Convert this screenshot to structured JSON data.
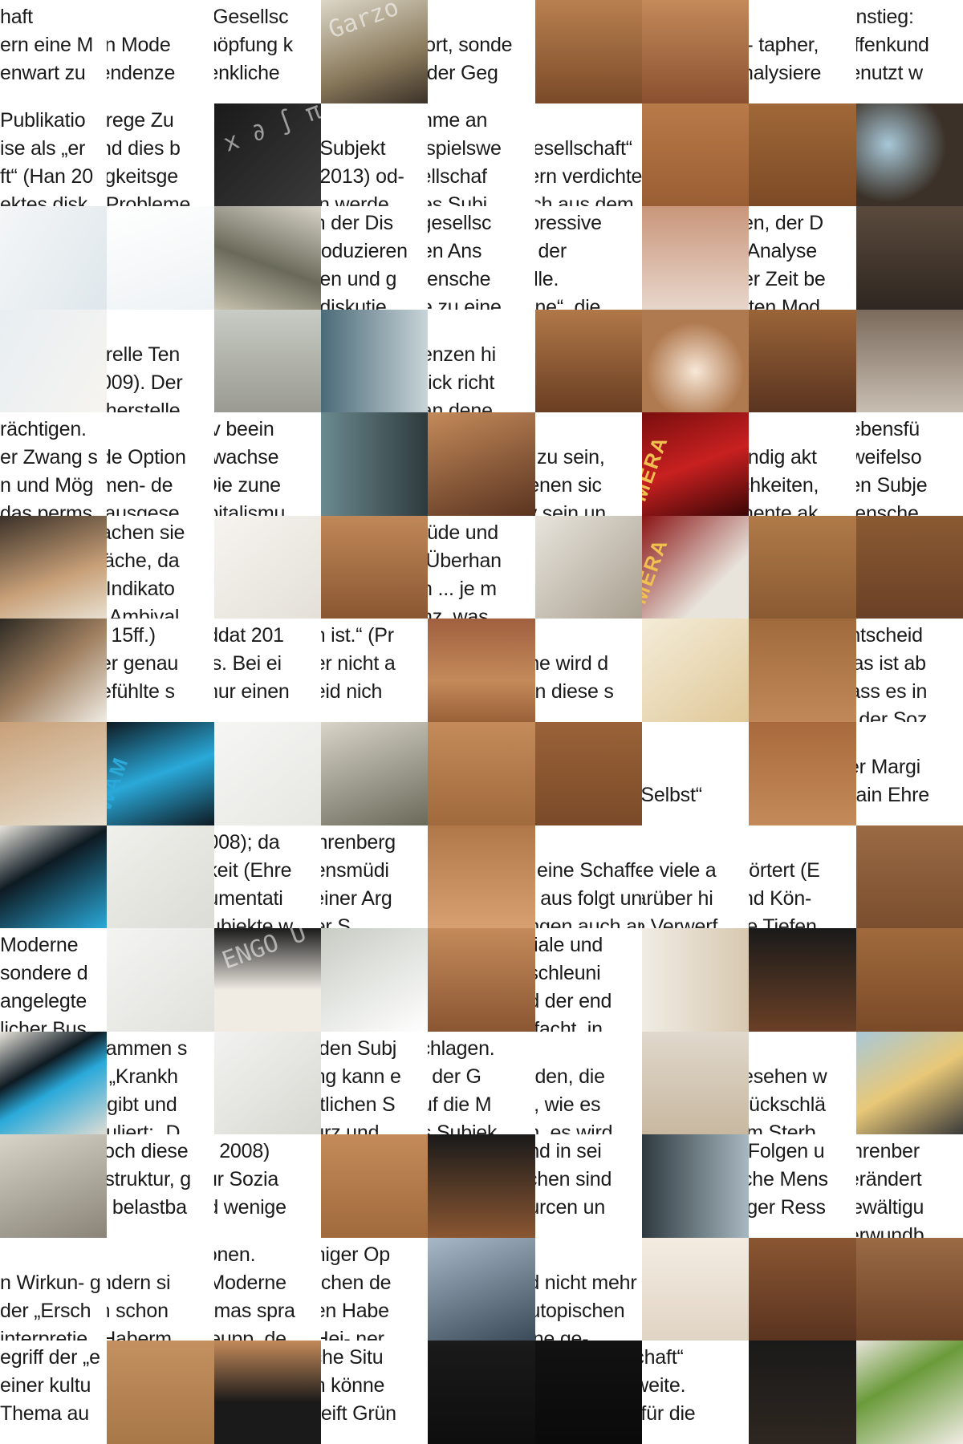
{
  "palette": {
    "skin_light": "#c48a5a",
    "skin_mid": "#a86a3c",
    "skin_dark": "#5a3420",
    "hair": "#3b3128",
    "sky": "#e7eef2",
    "book_red": "#a51a1a",
    "book_blue": "#2aa9d9",
    "chalkboard": "#2b2b2b",
    "paper": "#f2f0ea",
    "black": "#121212"
  },
  "cols": 9,
  "rows": 14,
  "tiles": [
    {
      "t": "text",
      "lines": [
        "haft",
        "ern eine M",
        "enwart zu"
      ]
    },
    {
      "t": "text",
      "lines": [
        "",
        "ein Mode",
        "Tendenze"
      ]
    },
    {
      "t": "text",
      "lines": [
        "e Gesellsc",
        "chöpfung k",
        "denkliche"
      ]
    },
    {
      "t": "photo",
      "bg": "linear-gradient(160deg,#dcd7c8,#8a7a5c 60%,#3b3128)",
      "glyph": "Garzo"
    },
    {
      "t": "text",
      "lines": [
        "",
        "wort, sonde",
        "n der Geg"
      ]
    },
    {
      "t": "photo",
      "bg": "linear-gradient(180deg,#b88050,#7a4a28)"
    },
    {
      "t": "photo",
      "bg": "linear-gradient(180deg,#c48a5a,#8a5030)"
    },
    {
      "t": "text",
      "lines": [
        "",
        "le- tapher,",
        "analysiere"
      ]
    },
    {
      "t": "text",
      "lines": [
        "Einstieg:",
        "Offenkund",
        "benutzt w"
      ]
    },
    {
      "t": "text",
      "lines": [
        "Publikatio",
        "ise als „er",
        "ft“ (Han 20",
        "ektes disk"
      ]
    },
    {
      "t": "text",
      "lines": [
        "e rege Zu",
        "und dies b",
        "digkeitsge",
        "n Probleme"
      ]
    },
    {
      "t": "photo",
      "bg": "linear-gradient(135deg,#1a1a1a,#3a3a3a)",
      "glyph": "x ∂ ∫ π √"
    },
    {
      "t": "text",
      "lines": [
        "",
        "e Subjekt",
        "d 2013) od-",
        "eln werde"
      ]
    },
    {
      "t": "text",
      "lines": [
        "ahme an",
        "eispielswe",
        "sellschaf",
        "des Subj"
      ]
    },
    {
      "t": "text",
      "lines": [
        "",
        "Gesellschaft“",
        "hern verdichten. Mit",
        "sich aus dem"
      ]
    },
    {
      "t": "photo",
      "bg": "linear-gradient(180deg,#b87a48,#9a5e34)"
    },
    {
      "t": "photo",
      "bg": "linear-gradient(180deg,#a06838,#7c4a26)"
    },
    {
      "t": "photo",
      "bg": "radial-gradient(circle at 30% 40%,#a8c8d8,#3b3128 60%)"
    },
    {
      "t": "photo",
      "bg": "linear-gradient(120deg,#f4f6f7,#dfe7ec)"
    },
    {
      "t": "photo",
      "bg": "linear-gradient(160deg,#ffffff,#eef2f4)"
    },
    {
      "t": "photo",
      "bg": "linear-gradient(200deg,#d8d4c8,#6a6a5a 55%,#c8c2b0)"
    },
    {
      "t": "text",
      "lines": [
        "on der Dis",
        "produzieren",
        "eten und g",
        "n diskutie"
      ]
    },
    {
      "t": "text",
      "lines": [
        "sgesellsc",
        "den Ans",
        "Mensche",
        "ge zu eine"
      ]
    },
    {
      "t": "text",
      "lines": [
        "epressive",
        "in der",
        "falle.",
        "erne“, die"
      ]
    },
    {
      "t": "photo",
      "bg": "linear-gradient(180deg,#c9967a,#e8d6cc)"
    },
    {
      "t": "text",
      "lines": [
        "ben, der D",
        "e Analyse",
        "ger Zeit be",
        "f- ten Mod"
      ]
    },
    {
      "t": "photo",
      "bg": "linear-gradient(180deg,#5a4a3c,#2e2620)"
    },
    {
      "t": "photo",
      "bg": "linear-gradient(120deg,#e8eef2,#f6f4f0)"
    },
    {
      "t": "text",
      "lines": [
        "",
        "turelle Ten",
        "2009). Der",
        "n herstelle"
      ]
    },
    {
      "t": "photo",
      "bg": "linear-gradient(180deg,#c8ccc4,#9a9a92)"
    },
    {
      "t": "photo",
      "bg": "linear-gradient(90deg,#4a6a78,#c8d4d8)"
    },
    {
      "t": "text",
      "lines": [
        "",
        "denzen hi",
        "Blick richt",
        ", an dene"
      ]
    },
    {
      "t": "photo",
      "bg": "linear-gradient(180deg,#b07848,#6a3e22)"
    },
    {
      "t": "photo",
      "bg": "radial-gradient(circle at 50% 60%,#f8e8d8,#b07a50 60%)"
    },
    {
      "t": "photo",
      "bg": "linear-gradient(180deg,#9a6438,#5a3420)"
    },
    {
      "t": "photo",
      "bg": "linear-gradient(180deg,#7a6a5c,#c8beb2)"
    },
    {
      "t": "text",
      "lines": [
        "rächtigen.",
        "er Zwang s",
        "n und Mög",
        "das perms"
      ]
    },
    {
      "t": "text",
      "lines": [
        "",
        "nde Option",
        "hmen- de",
        "s ausgese"
      ]
    },
    {
      "t": "text",
      "lines": [
        "siv beein",
        "s wachse",
        "„Die zune",
        "apitalismu"
      ]
    },
    {
      "t": "photo",
      "bg": "linear-gradient(90deg,#6a8a90,#2e3a3c)"
    },
    {
      "t": "photo",
      "bg": "linear-gradient(160deg,#c48a5a,#5a3420)"
    },
    {
      "t": "text",
      "lines": [
        "",
        "iv zu sein,",
        "denen sic",
        "tiv sein un"
      ]
    },
    {
      "t": "photo",
      "bg": "linear-gradient(160deg,#7a0e0e,#c82020 50%,#3a0606)",
      "spine": "MERA"
    },
    {
      "t": "text",
      "lines": [
        "",
        "tändig akt",
        "lichkeiten,",
        "anente ak"
      ]
    },
    {
      "t": "text",
      "lines": [
        "Lebensfü",
        "Zweifelso",
        "den Subje",
        "Mensche"
      ]
    },
    {
      "t": "photo",
      "bg": "linear-gradient(160deg,#3b3128,#c8a078 60%,#e8e0d0)"
    },
    {
      "t": "text",
      "lines": [
        "nachen sie",
        "wäche, da",
        "e Indikato",
        "ie Ambival"
      ]
    },
    {
      "t": "photo",
      "bg": "linear-gradient(140deg,#f6f4f0,#e4e0d8)"
    },
    {
      "t": "photo",
      "bg": "linear-gradient(180deg,#c08858,#8a5632)"
    },
    {
      "t": "text",
      "lines": [
        "müde und",
        "s Überhan",
        "en ... je m",
        "enz, was"
      ]
    },
    {
      "t": "photo",
      "bg": "linear-gradient(135deg,#e8e4dc,#a8a090)"
    },
    {
      "t": "photo",
      "bg": "linear-gradient(135deg,#8a1414,#e8e4dc 70%)",
      "spine": "MERA"
    },
    {
      "t": "photo",
      "bg": "linear-gradient(180deg,#b07a48,#8a5a32)"
    },
    {
      "t": "photo",
      "bg": "linear-gradient(180deg,#8a5a32,#6a4026)"
    },
    {
      "t": "photo",
      "bg": "linear-gradient(140deg,#2e2a24,#a08060 50%,#f0ece4)"
    },
    {
      "t": "text",
      "lines": [
        "2, 15ff.)",
        "ner genau",
        "gefühlte s"
      ]
    },
    {
      "t": "text",
      "lines": [
        "riddat 201",
        "les. Bei ei",
        "t nur einen"
      ]
    },
    {
      "t": "text",
      "lines": [
        "en ist.“ (Pr",
        "ber nicht a",
        "Leid nich"
      ]
    },
    {
      "t": "photo",
      "bg": "linear-gradient(180deg,#a06040,#c48a5a 60%,#9a6038)"
    },
    {
      "t": "text",
      "lines": [
        "",
        "ene wird d",
        "ern diese s"
      ]
    },
    {
      "t": "photo",
      "bg": "linear-gradient(140deg,#f4ecd8,#e0c898)"
    },
    {
      "t": "photo",
      "bg": "linear-gradient(180deg,#a06a3c,#c08858)"
    },
    {
      "t": "text",
      "lines": [
        "entscheid",
        "Das ist ab",
        "dass es in",
        "in der Soz"
      ]
    },
    {
      "t": "photo",
      "bg": "linear-gradient(160deg,#c8a078,#e8e0d0)"
    },
    {
      "t": "photo",
      "bg": "linear-gradient(160deg,#0e1a22,#2aa9d9 50%,#0e1a22)",
      "spine": "WAM"
    },
    {
      "t": "photo",
      "bg": "linear-gradient(140deg,#f6f6f4,#e6e6e2)"
    },
    {
      "t": "photo",
      "bg": "linear-gradient(160deg,#d8d4c8,#6a6a5a)"
    },
    {
      "t": "photo",
      "bg": "linear-gradient(180deg,#c48a5a,#a06a3c)"
    },
    {
      "t": "photo",
      "bg": "linear-gradient(180deg,#9a6238,#7a4a28)"
    },
    {
      "t": "text",
      "lines": [
        "",
        "",
        "e Selbst“"
      ]
    },
    {
      "t": "photo",
      "bg": "linear-gradient(180deg,#a86a3c,#c48a5a)"
    },
    {
      "t": "text",
      "lines": [
        "",
        "ver Margi",
        "Alain Ehre"
      ]
    },
    {
      "t": "photo",
      "bg": "linear-gradient(150deg,#e8e4dc,#0e1a22 40%,#2aa9d9)"
    },
    {
      "t": "photo",
      "bg": "linear-gradient(140deg,#f0f0ec,#dcdcd6)"
    },
    {
      "t": "text",
      "lines": [
        "2008); da",
        "gkeit (Ehre",
        "gumentati",
        "Subjekte w"
      ]
    },
    {
      "t": "text",
      "lines": [
        "Ehrenberg",
        "nensmüdi",
        "seiner Arg",
        "der S"
      ]
    },
    {
      "t": "photo",
      "bg": "linear-gradient(180deg,#b07848,#d8a070)"
    },
    {
      "t": "text",
      "lines": [
        "",
        "ls eine Schaffens-",
        "n- aus folgt und in",
        "ungen auch anders"
      ]
    },
    {
      "t": "text",
      "lines": [
        "",
        "wie viele a",
        "darüber hi",
        "se Verwerf"
      ]
    },
    {
      "t": "text",
      "lines": [
        "",
        "erörtert (E",
        "und Kön-",
        "die Tiefen"
      ]
    },
    {
      "t": "photo",
      "bg": "linear-gradient(180deg,#9a6a44,#7a4e2e)"
    },
    {
      "t": "text",
      "lines": [
        "Moderne",
        "sondere d",
        "angelegte",
        "licher Bus"
      ]
    },
    {
      "t": "photo",
      "bg": "linear-gradient(140deg,#f4f4f2,#e0e0dc)"
    },
    {
      "t": "photo",
      "bg": "linear-gradient(180deg,#1a1a1a,#f0ece4 60%)",
      "glyph": "ENGO U"
    },
    {
      "t": "photo",
      "bg": "linear-gradient(150deg,#c8ccc4,#ffffff)"
    },
    {
      "t": "photo",
      "bg": "linear-gradient(180deg,#c48a5a,#8a5632)"
    },
    {
      "t": "text",
      "lines": [
        "ntiale und",
        "eschleuni",
        "nd der end",
        "ntfacht, in"
      ]
    },
    {
      "t": "photo",
      "bg": "linear-gradient(90deg,#f0ece4,#d8c8b0)"
    },
    {
      "t": "photo",
      "bg": "linear-gradient(180deg,#1a1a1a,#6a4026)"
    },
    {
      "t": "photo",
      "bg": "linear-gradient(180deg,#a06a3c,#7a4a28)"
    },
    {
      "t": "photo",
      "bg": "linear-gradient(150deg,#e8e4dc,#0e1a22 35%,#2aa9d9 55%,#e0dcd4)"
    },
    {
      "t": "text",
      "lines": [
        "Flammen s",
        "ls „Krankh",
        "ergibt und",
        "muliert: „D"
      ]
    },
    {
      "t": "photo",
      "bg": "linear-gradient(140deg,#f2f2f0,#d8d8d2)"
    },
    {
      "t": "text",
      "lines": [
        "s den Subj",
        "ung kann e",
        "aftlichen S",
        "kurz und"
      ]
    },
    {
      "t": "text",
      "lines": [
        "schlagen.",
        "it“ der G",
        "auf die M",
        "as Subjek"
      ]
    },
    {
      "t": "text",
      "lines": [
        "",
        "erden, die",
        "gt, wie es",
        "en, es wird"
      ]
    },
    {
      "t": "photo",
      "bg": "linear-gradient(180deg,#e0d8cc,#c8b8a0)"
    },
    {
      "t": "text",
      "lines": [
        "",
        "gesehen w",
        "urückschlä",
        "t im Sterb"
      ]
    },
    {
      "t": "photo",
      "bg": "linear-gradient(150deg,#a8c8d8,#e8c878 50%,#3a3a3a)"
    },
    {
      "t": "photo",
      "bg": "linear-gradient(160deg,#d8d4c8,#8a8478)"
    },
    {
      "t": "text",
      "lines": [
        "Doch diese",
        "alstruktur, g",
        "er belastba"
      ]
    },
    {
      "t": "text",
      "lines": [
        "rg 2008)",
        "zur Sozia",
        "nd wenige"
      ]
    },
    {
      "t": "photo",
      "bg": "linear-gradient(180deg,#c48a5a,#a06a3c)"
    },
    {
      "t": "photo",
      "bg": "linear-gradient(180deg,#1a1a1a,#8a5632)"
    },
    {
      "t": "text",
      "lines": [
        "und in sei",
        "schen sind",
        "ourcen un"
      ]
    },
    {
      "t": "photo",
      "bg": "linear-gradient(90deg,#2e3a40,#a8b8c0)"
    },
    {
      "t": "text",
      "lines": [
        "n Folgen u",
        "nche Mens",
        "niger Ress"
      ]
    },
    {
      "t": "text",
      "lines": [
        "Ehrenber",
        "verändert",
        "Bewältigu",
        "verwundb"
      ]
    },
    {
      "t": "text",
      "lines": [
        "",
        "n Wirkun- g",
        "der „Ersch",
        "interpretie"
      ]
    },
    {
      "t": "text",
      "lines": [
        "",
        "ändern si",
        "ch schon",
        "r Haberm"
      ]
    },
    {
      "t": "text",
      "lines": [
        "tionen.",
        "r Moderne",
        "ermas spra",
        "Keupp, de"
      ]
    },
    {
      "t": "text",
      "lines": [
        "eniger Op",
        "rechen de",
        "gen Habe",
        ": Hei- ner"
      ]
    },
    {
      "t": "photo",
      "bg": "linear-gradient(160deg,#a8b8c8,#3a4a58)"
    },
    {
      "t": "text",
      "lines": [
        "",
        "nd nicht mehr für alle",
        "r utopischen",
        "eine ge-"
      ]
    },
    {
      "t": "photo",
      "bg": "linear-gradient(180deg,#f4ece2,#e0d4c4)"
    },
    {
      "t": "photo",
      "bg": "linear-gradient(180deg,#8a5632,#5a3420)"
    },
    {
      "t": "photo",
      "bg": "linear-gradient(180deg,#9a6a44,#6a4026)"
    },
    {
      "t": "text",
      "lines": [
        "egriff der „e",
        "einer kultu",
        "Thema au"
      ]
    },
    {
      "t": "photo",
      "bg": "linear-gradient(180deg,#c49060,#a87848)"
    },
    {
      "t": "photo",
      "bg": "linear-gradient(180deg,#c48a5a,#1a1a1a 60%)"
    },
    {
      "t": "text",
      "lines": [
        "liche Situ",
        "en könne",
        "greift Grün"
      ]
    },
    {
      "t": "photo",
      "bg": "linear-gradient(180deg,#1a1a1a,#0e0e0e)"
    },
    {
      "t": "photo",
      "bg": "linear-gradient(180deg,#121212,#0a0a0a)"
    },
    {
      "t": "text",
      "lines": [
        "schaft“",
        "sweite.",
        "d für die"
      ]
    },
    {
      "t": "photo",
      "bg": "linear-gradient(180deg,#1a1a1a,#2e2620)"
    },
    {
      "t": "photo",
      "bg": "linear-gradient(150deg,#e8e4dc,#6a9a3a 40%,#f0ece4)"
    }
  ]
}
